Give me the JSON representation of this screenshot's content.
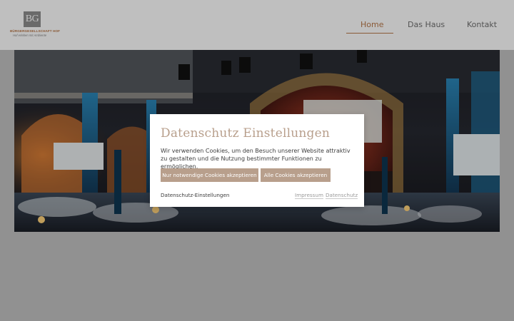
{
  "logo": {
    "initials": "BG",
    "name": "BÜRGERGESELLSCHAFT HOF",
    "tagline": "Hof erleben mit Ambiente"
  },
  "nav": {
    "items": [
      {
        "label": "Home",
        "active": true
      },
      {
        "label": "Das Haus",
        "active": false
      },
      {
        "label": "Kontakt",
        "active": false
      }
    ]
  },
  "hero": {
    "icon": "event-hall-photo"
  },
  "cookie_modal": {
    "title": "Datenschutz Einstellungen",
    "text": "Wir verwenden Cookies, um den Besuch unserer Website attraktiv zu gestalten und die Nutzung bestimmter Funktionen zu ermöglichen.",
    "btn_necessary": "Nur notwendige Cookies akzeptieren",
    "btn_all": "Alle Cookies akzeptieren",
    "settings_link": "Datenschutz-Einstellungen",
    "impressum_link": "Impressum",
    "datenschutz_link": "Datenschutz"
  },
  "colors": {
    "accent": "#b9794a",
    "button": "#b89f8c",
    "page_bg": "#c2c2c2"
  }
}
